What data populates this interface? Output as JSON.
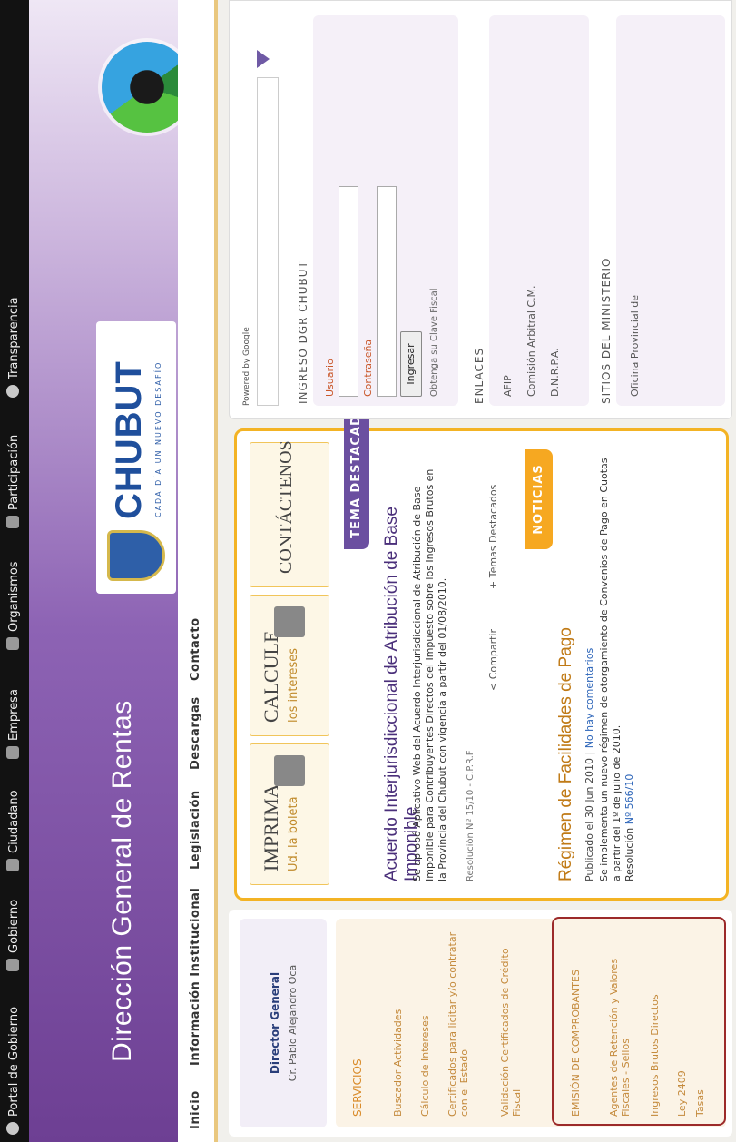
{
  "topbar": {
    "items": [
      "Portal de Gobierno",
      "Gobierno",
      "Ciudadano",
      "Empresa",
      "Organismos",
      "Participación",
      "Transparencia"
    ]
  },
  "header": {
    "title": "Dirección General de Rentas",
    "logo_text": "CHUBUT",
    "logo_tagline": "CADA DÍA UN NUEVO DESAFÍO"
  },
  "nav": {
    "items": [
      "Inicio",
      "Información Institucional",
      "Legislación",
      "Descargas",
      "Contacto"
    ]
  },
  "left": {
    "director_title": "Director General",
    "director_name": "Cr. Pablo Alejandro Oca",
    "services_heading": "SERVICIOS",
    "services": [
      "Buscador Actividades",
      "Cálculo de Intereses",
      "Certificados para licitar y/o contratar con el Estado",
      "Validación Certificados de Crédito Fiscal",
      "EMISIÓN DE COMPROBANTES",
      "Agentes de Retención y Valores Fiscales - Sellos",
      "Ingresos Brutos Directos",
      "Ley 2409",
      "Tasas"
    ]
  },
  "featured": {
    "btn1_big": "IMPRIMA",
    "btn1_small": "Ud. la boleta",
    "btn2_big": "CALCULE",
    "btn2_small": "los intereses",
    "btn3_big": "CONTÁCTENOS",
    "tema_banner": "TEMA DESTACADO",
    "tema_title": "Acuerdo Interjurisdiccional de Atribución de Base Imponible",
    "tema_text": "Se aprobó Aplicativo Web del Acuerdo Interjurisdiccional de Atribución de Base Imponible para Contribuyentes Directos del Impuesto sobre los Ingresos Brutos en la Provincia del Chubut con vigencia a partir del 01/08/2010.",
    "tema_res": "Resolución Nº 15/10 - C.P.R.F",
    "share": "Compartir",
    "temas": "Temas Destacados",
    "noticias_banner": "NOTICIAS",
    "news_title": "Régimen de Facilidades de Pago",
    "news_meta_pre": "Publicado el 30 Jun 2010 |",
    "news_meta_link": "No hay comentarios",
    "news_text": "Se implementa un nuevo régimen de otorgamiento de Convenios de Pago en Cuotas a partir del 1º de julio de 2010.",
    "news_res_pre": "Resolución",
    "news_res_link": "Nº 566/10"
  },
  "right": {
    "google_label": "Powered by Google",
    "ingreso_heading": "INGRESO DGR CHUBUT",
    "usuario_label": "Usuario",
    "pass_label": "Contraseña",
    "ingresar": "Ingresar",
    "clave": "Obtenga su Clave Fiscal",
    "enlaces_heading": "ENLACES",
    "enlaces": [
      "AFIP",
      "Comisión Arbitral C.M.",
      "D.N.R.P.A."
    ],
    "sitios_heading": "SITIOS DEL MINISTERIO",
    "sitios": [
      "Oficina Provincial de"
    ]
  }
}
